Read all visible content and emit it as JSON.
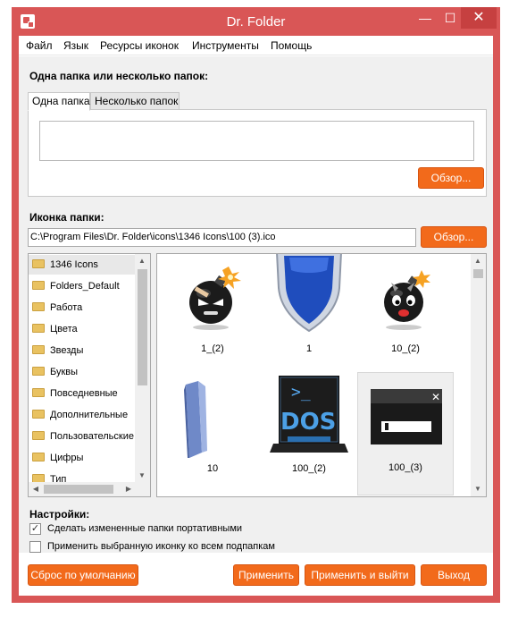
{
  "window": {
    "title": "Dr. Folder",
    "minimize": "—",
    "maximize": "☐",
    "close": "✕"
  },
  "menu": [
    "Файл",
    "Язык",
    "Ресурсы иконок",
    "Инструменты",
    "Помощь"
  ],
  "folders_section": {
    "heading": "Одна папка или несколько папок:",
    "tabs": [
      "Одна папка",
      "Несколько папок"
    ],
    "active_tab": 0,
    "browse_label": "Обзор..."
  },
  "icon_section": {
    "heading": "Иконка папки:",
    "path": "C:\\Program Files\\Dr. Folder\\icons\\1346 Icons\\100 (3).ico",
    "browse_label": "Обзор..."
  },
  "tree": {
    "items": [
      "1346 Icons",
      "Folders_Default",
      "Работа",
      "Цвета",
      "Звезды",
      "Буквы",
      "Повседневные",
      "Дополнительные",
      "Пользовательские",
      "Цифры",
      "Тип"
    ],
    "selected": 0
  },
  "icons": {
    "items": [
      {
        "label": "1_(2)",
        "kind": "bomb-face"
      },
      {
        "label": "1",
        "kind": "shield"
      },
      {
        "label": "10_(2)",
        "kind": "bomb-devil"
      },
      {
        "label": "10",
        "kind": "blue-folder"
      },
      {
        "label": "100_(2)",
        "kind": "dos-terminal"
      },
      {
        "label": "100_(3)",
        "kind": "window-dialog"
      }
    ],
    "selected": 5
  },
  "settings": {
    "heading": "Настройки:",
    "options": [
      {
        "label": "Сделать измененные папки портативными",
        "checked": true
      },
      {
        "label": "Применить выбранную иконку ко всем подпапкам",
        "checked": false
      }
    ]
  },
  "footer": {
    "reset": "Сброс по умолчанию",
    "apply": "Применить",
    "apply_exit": "Применить и выйти",
    "exit": "Выход"
  },
  "dos_text": "DOS",
  "dos_prompt": ">_",
  "colors": {
    "title_bar": "#d95656",
    "accent_button": "#f26a1b"
  }
}
